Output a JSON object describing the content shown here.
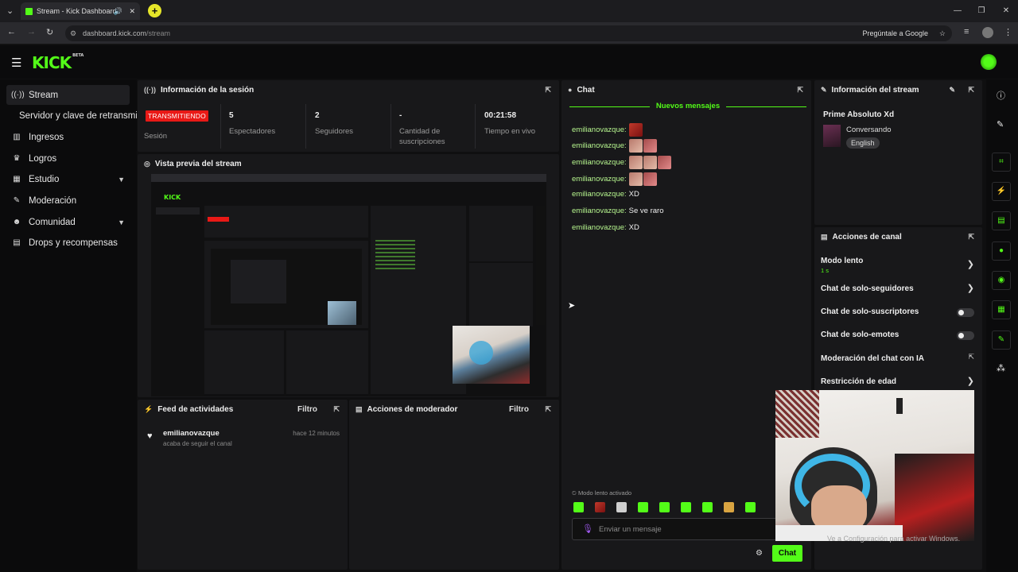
{
  "browser": {
    "tab_title": "Stream - Kick Dashboard",
    "url_host": "dashboard.kick.com",
    "url_path": "/stream",
    "google_button": "Pregúntale a Google"
  },
  "header": {
    "logo": "KICK",
    "logo_badge": "BETA"
  },
  "sidebar": {
    "items": [
      {
        "label": "Stream",
        "icon": "broadcast-icon"
      },
      {
        "label": "Servidor y clave de retransmi"
      },
      {
        "label": "Ingresos",
        "icon": "chart-icon"
      },
      {
        "label": "Logros",
        "icon": "trophy-icon"
      },
      {
        "label": "Estudio",
        "icon": "layout-icon"
      },
      {
        "label": "Moderación",
        "icon": "wrench-icon"
      },
      {
        "label": "Comunidad",
        "icon": "users-icon"
      },
      {
        "label": "Drops y recompensas",
        "icon": "gift-icon"
      }
    ]
  },
  "session": {
    "title": "Información de la sesión",
    "status_badge": "TRANSMITIENDO",
    "status_label": "Sesión",
    "viewers_value": "5",
    "viewers_label": "Espectadores",
    "followers_value": "2",
    "followers_label": "Seguidores",
    "subs_value": "-",
    "subs_label": "Cantidad de suscripciones",
    "uptime_value": "00:21:58",
    "uptime_label": "Tiempo en vivo"
  },
  "preview": {
    "title": "Vista previa del stream"
  },
  "activity": {
    "title": "Feed de actividades",
    "filter": "Filtro",
    "items": [
      {
        "user": "emilianovazque",
        "time": "hace 12 minutos",
        "text": "acaba de seguir el canal"
      }
    ]
  },
  "mod_actions": {
    "title": "Acciones de moderador",
    "filter": "Filtro"
  },
  "chat": {
    "title": "Chat",
    "new_messages": "Nuevos mensajes",
    "messages": [
      {
        "user": "emilianovazque:",
        "text": ""
      },
      {
        "user": "emilianovazque:",
        "text": ""
      },
      {
        "user": "emilianovazque:",
        "text": ""
      },
      {
        "user": "emilianovazque:",
        "text": ""
      },
      {
        "user": "emilianovazque:",
        "text": "XD"
      },
      {
        "user": "emilianovazque:",
        "text": "Se ve raro"
      },
      {
        "user": "emilianovazque:",
        "text": "XD"
      }
    ],
    "slow_mode_note": "Modo lento activado",
    "input_placeholder": "Enviar un mensaje",
    "send_label": "Chat"
  },
  "stream_info": {
    "title": "Información del stream",
    "stream_title": "Prime Absoluto Xd",
    "category": "Conversando",
    "language": "English"
  },
  "channel_actions": {
    "title": "Acciones de canal",
    "slow_mode": "Modo lento",
    "slow_mode_value": "1 s",
    "followers_only": "Chat de solo-seguidores",
    "subs_only": "Chat de solo-suscriptores",
    "emotes_only": "Chat de solo-emotes",
    "ai_moderation": "Moderación del chat con IA",
    "age_restriction": "Restricción de edad"
  },
  "windows_watermark": "Ve a Configuración para activar Windows.",
  "colors": {
    "accent": "#53fc18",
    "live": "#e91916",
    "panel": "#18181a",
    "background": "#0f0f10"
  }
}
